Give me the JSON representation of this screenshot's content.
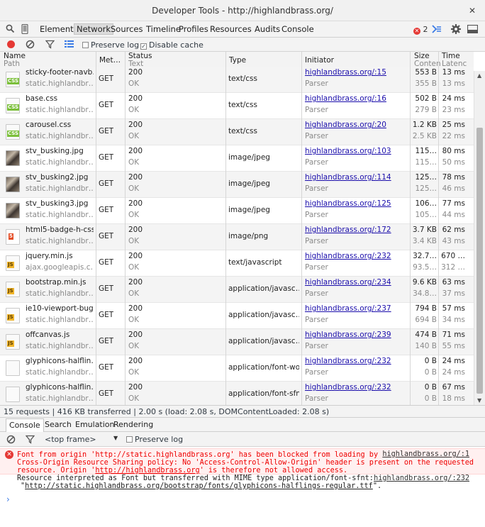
{
  "window": {
    "title": "Developer Tools - http://highlandbrass.org/",
    "close": "✕"
  },
  "panels": {
    "tabs": [
      "Elements",
      "Network",
      "Sources",
      "Timeline",
      "Profiles",
      "Resources",
      "Audits",
      "Console"
    ],
    "active": "Network",
    "error_count": "2"
  },
  "network_toolbar": {
    "preserve_log": "Preserve log",
    "disable_cache": "Disable cache"
  },
  "columns": {
    "name": "Name",
    "path": "Path",
    "method": "Met…",
    "status": "Status",
    "text": "Text",
    "type": "Type",
    "initiator": "Initiator",
    "size": "Size",
    "content": "Conten",
    "time": "Time",
    "latency": "Latenc"
  },
  "requests": [
    {
      "icon": "css-file-icon",
      "name": "sticky-footer-navb…",
      "path": "static.highlandbr…",
      "method": "GET",
      "status": "200",
      "text": "OK",
      "type": "text/css",
      "initiator": "highlandbrass.org/:15",
      "initiator_type": "Parser",
      "size": "553 B",
      "content": "355 B",
      "time": "13 ms",
      "latency": "13 ms"
    },
    {
      "icon": "css-file-icon",
      "name": "base.css",
      "path": "static.highlandbr…",
      "method": "GET",
      "status": "200",
      "text": "OK",
      "type": "text/css",
      "initiator": "highlandbrass.org/:16",
      "initiator_type": "Parser",
      "size": "502 B",
      "content": "279 B",
      "time": "24 ms",
      "latency": "23 ms"
    },
    {
      "icon": "css-file-icon",
      "name": "carousel.css",
      "path": "static.highlandbr…",
      "method": "GET",
      "status": "200",
      "text": "OK",
      "type": "text/css",
      "initiator": "highlandbrass.org/:20",
      "initiator_type": "Parser",
      "size": "1.2 KB",
      "content": "2.5 KB",
      "time": "25 ms",
      "latency": "22 ms"
    },
    {
      "icon": "image-thumbnail-icon",
      "name": "stv_busking.jpg",
      "path": "static.highlandbr…",
      "method": "GET",
      "status": "200",
      "text": "OK",
      "type": "image/jpeg",
      "initiator": "highlandbrass.org/:103",
      "initiator_type": "Parser",
      "size": "115…",
      "content": "115…",
      "time": "80 ms",
      "latency": "50 ms"
    },
    {
      "icon": "image-thumbnail-icon",
      "name": "stv_busking2.jpg",
      "path": "static.highlandbr…",
      "method": "GET",
      "status": "200",
      "text": "OK",
      "type": "image/jpeg",
      "initiator": "highlandbrass.org/:114",
      "initiator_type": "Parser",
      "size": "125…",
      "content": "125…",
      "time": "78 ms",
      "latency": "46 ms"
    },
    {
      "icon": "image-thumbnail-icon",
      "name": "stv_busking3.jpg",
      "path": "static.highlandbr…",
      "method": "GET",
      "status": "200",
      "text": "OK",
      "type": "image/jpeg",
      "initiator": "highlandbrass.org/:125",
      "initiator_type": "Parser",
      "size": "106…",
      "content": "105…",
      "time": "77 ms",
      "latency": "44 ms"
    },
    {
      "icon": "html5-badge-icon",
      "name": "html5-badge-h-css…",
      "path": "static.highlandbr…",
      "method": "GET",
      "status": "200",
      "text": "OK",
      "type": "image/png",
      "initiator": "highlandbrass.org/:172",
      "initiator_type": "Parser",
      "size": "3.7 KB",
      "content": "3.4 KB",
      "time": "62 ms",
      "latency": "43 ms"
    },
    {
      "icon": "js-file-icon",
      "name": "jquery.min.js",
      "path": "ajax.googleapis.c…",
      "method": "GET",
      "status": "200",
      "text": "OK",
      "type": "text/javascript",
      "initiator": "highlandbrass.org/:232",
      "initiator_type": "Parser",
      "size": "32.7…",
      "content": "93.5…",
      "time": "670 …",
      "latency": "312 …"
    },
    {
      "icon": "js-file-icon",
      "name": "bootstrap.min.js",
      "path": "static.highlandbr…",
      "method": "GET",
      "status": "200",
      "text": "OK",
      "type": "application/javasc…",
      "initiator": "highlandbrass.org/:234",
      "initiator_type": "Parser",
      "size": "9.6 KB",
      "content": "34.8…",
      "time": "63 ms",
      "latency": "37 ms"
    },
    {
      "icon": "js-file-icon",
      "name": "ie10-viewport-bug…",
      "path": "static.highlandbr…",
      "method": "GET",
      "status": "200",
      "text": "OK",
      "type": "application/javasc…",
      "initiator": "highlandbrass.org/:237",
      "initiator_type": "Parser",
      "size": "794 B",
      "content": "694 B",
      "time": "57 ms",
      "latency": "34 ms"
    },
    {
      "icon": "js-file-icon",
      "name": "offcanvas.js",
      "path": "static.highlandbr…",
      "method": "GET",
      "status": "200",
      "text": "OK",
      "type": "application/javasc…",
      "initiator": "highlandbrass.org/:239",
      "initiator_type": "Parser",
      "size": "474 B",
      "content": "140 B",
      "time": "71 ms",
      "latency": "55 ms"
    },
    {
      "icon": "blank-file-icon",
      "name": "glyphicons-halflin…",
      "path": "static.highlandbr…",
      "method": "GET",
      "status": "200",
      "text": "OK",
      "type": "application/font-woff",
      "initiator": "highlandbrass.org/:232",
      "initiator_type": "Parser",
      "size": "0 B",
      "content": "0 B",
      "time": "24 ms",
      "latency": "24 ms"
    },
    {
      "icon": "blank-file-icon",
      "name": "glyphicons-halflin…",
      "path": "static.highlandbr…",
      "method": "GET",
      "status": "200",
      "text": "OK",
      "type": "application/font-sfnt",
      "initiator": "highlandbrass.org/:232",
      "initiator_type": "Parser",
      "size": "0 B",
      "content": "0 B",
      "time": "67 ms",
      "latency": "18 ms"
    }
  ],
  "summary": "15 requests  |  416 KB transferred  |  2.00 s (load: 2.08 s, DOMContentLoaded: 2.08 s)",
  "drawer": {
    "tabs": [
      "Console",
      "Search",
      "Emulation",
      "Rendering"
    ],
    "active": "Console"
  },
  "console_toolbar": {
    "frame": "<top frame>",
    "preserve_log": "Preserve log"
  },
  "console": {
    "error": {
      "line1": "Font from origin 'http://static.highlandbrass.org' has been blocked from loading by",
      "line2": "Cross-Origin Resource Sharing policy: No 'Access-Control-Allow-Origin' header is present on the requested",
      "line3_pre": "resource. Origin '",
      "line3_link": "http://highlandbrass.org",
      "line3_post": "' is therefore not allowed access.",
      "source": "highlandbrass.org/:1"
    },
    "log": {
      "line1": "Resource interpreted as Font but transferred with MIME type application/font-sfnt:",
      "line2_pre": "\"",
      "line2_link": "http://static.highlandbrass.org/bootstrap/fonts/glyphicons-halflings-regular.ttf",
      "line2_post": "\".",
      "source": "highlandbrass.org/:232"
    },
    "prompt": "›"
  },
  "colors": {
    "record": "#e53935",
    "accent": "#3b7be6",
    "link": "#1a0dab",
    "error_bg": "#fff0f0"
  }
}
